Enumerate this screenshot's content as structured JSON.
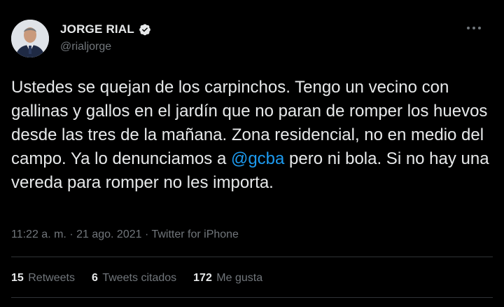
{
  "author": {
    "display_name": "JORGE RIAL",
    "handle": "@rialjorge",
    "verified_icon": "verified-badge-icon"
  },
  "tweet": {
    "text_part1": "Ustedes se quejan de los carpinchos. Tengo un vecino con gallinas y gallos en el jardín que no paran de romper los huevos desde las tres de la mañana. Zona residencial, no en medio del campo. Ya lo denunciamos a ",
    "mention": "@gcba",
    "text_part2": " pero ni bola. Si no hay una vereda para romper no les importa."
  },
  "meta": {
    "time": "11:22 a. m.",
    "date": "21 ago. 2021",
    "separator": "·",
    "source": "Twitter for iPhone"
  },
  "stats": {
    "retweets_count": "15",
    "retweets_label": "Retweets",
    "quotes_count": "6",
    "quotes_label": "Tweets citados",
    "likes_count": "172",
    "likes_label": "Me gusta"
  },
  "colors": {
    "background": "#000000",
    "text": "#e7e9ea",
    "secondary": "#71767b",
    "accent": "#1d9bf0",
    "divider": "#2f3336"
  }
}
